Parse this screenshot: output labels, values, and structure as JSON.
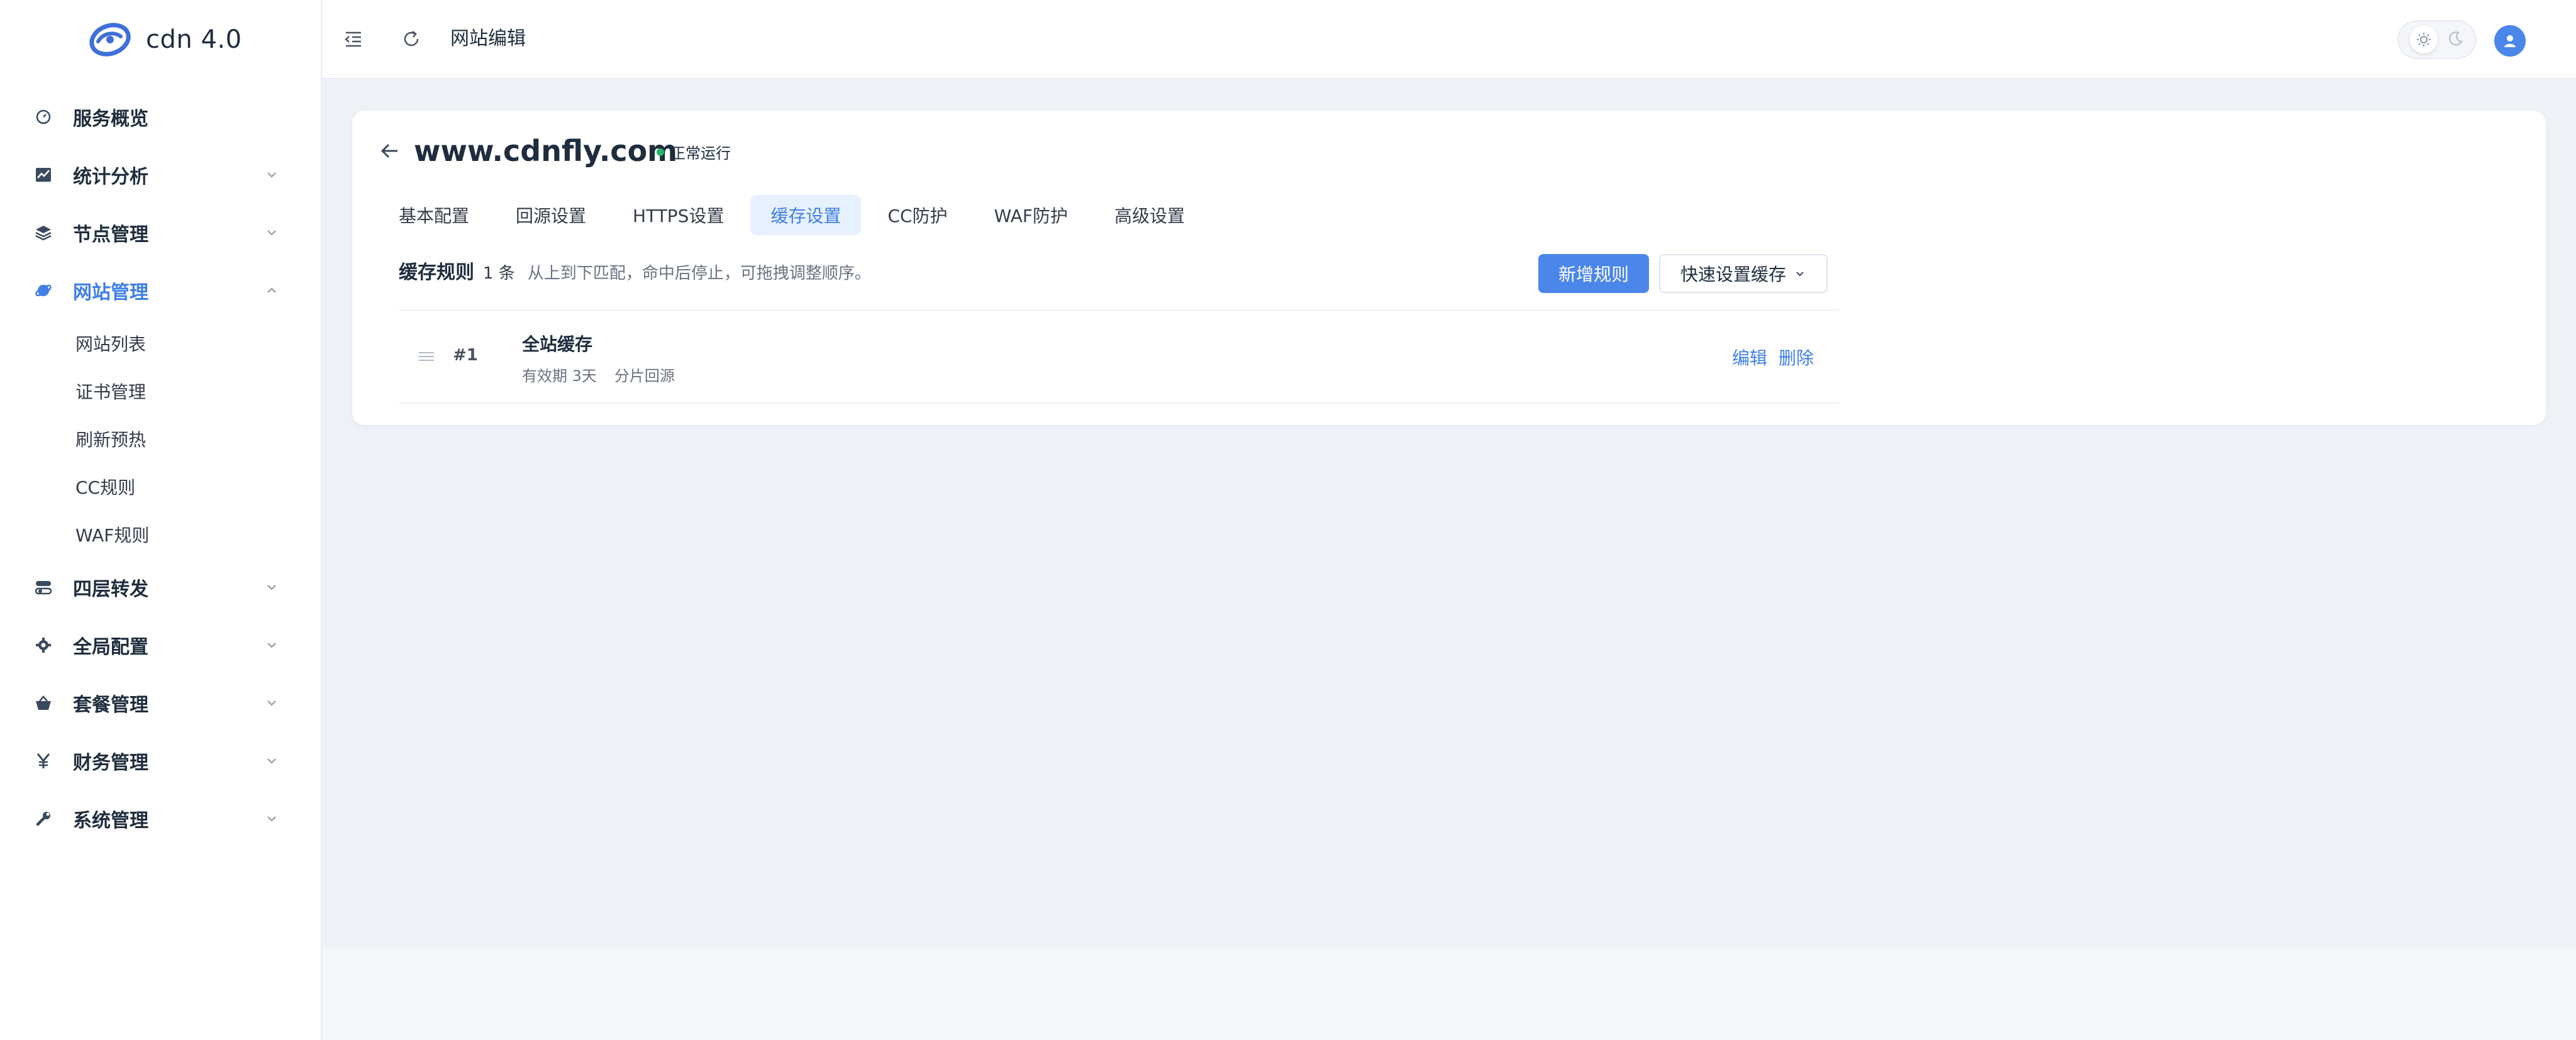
{
  "brand": {
    "name": "cdn 4.0"
  },
  "sidebar": {
    "items": [
      {
        "label": "服务概览",
        "icon": "dashboard-icon"
      },
      {
        "label": "统计分析",
        "icon": "chart-icon"
      },
      {
        "label": "节点管理",
        "icon": "layers-icon"
      },
      {
        "label": "网站管理",
        "icon": "globe-icon",
        "expanded": true
      },
      {
        "label": "四层转发",
        "icon": "toggle-icon"
      },
      {
        "label": "全局配置",
        "icon": "gear-icon"
      },
      {
        "label": "套餐管理",
        "icon": "basket-icon"
      },
      {
        "label": "财务管理",
        "icon": "yen-icon"
      },
      {
        "label": "系统管理",
        "icon": "wrench-icon"
      }
    ],
    "submenu": [
      "网站列表",
      "证书管理",
      "刷新预热",
      "CC规则",
      "WAF规则"
    ]
  },
  "topbar": {
    "page_title": "网站编辑"
  },
  "site": {
    "domain": "www.cdnfly.com",
    "status": "正常运行"
  },
  "tabs": [
    "基本配置",
    "回源设置",
    "HTTPS设置",
    "缓存设置",
    "CC防护",
    "WAF防护",
    "高级设置"
  ],
  "active_tab": "缓存设置",
  "cache_rules": {
    "title": "缓存规则",
    "count": "1 条",
    "hint": "从上到下匹配，命中后停止，可拖拽调整顺序。",
    "add_button": "新增规则",
    "quick_button": "快速设置缓存",
    "rows": [
      {
        "index": "#1",
        "name": "全站缓存",
        "expire": "有效期 3天",
        "mode": "分片回源",
        "edit": "编辑",
        "delete": "删除"
      }
    ]
  },
  "colors": {
    "accent": "#4b86ea",
    "active_text": "#3f7fe6",
    "status_green": "#29b46a"
  }
}
